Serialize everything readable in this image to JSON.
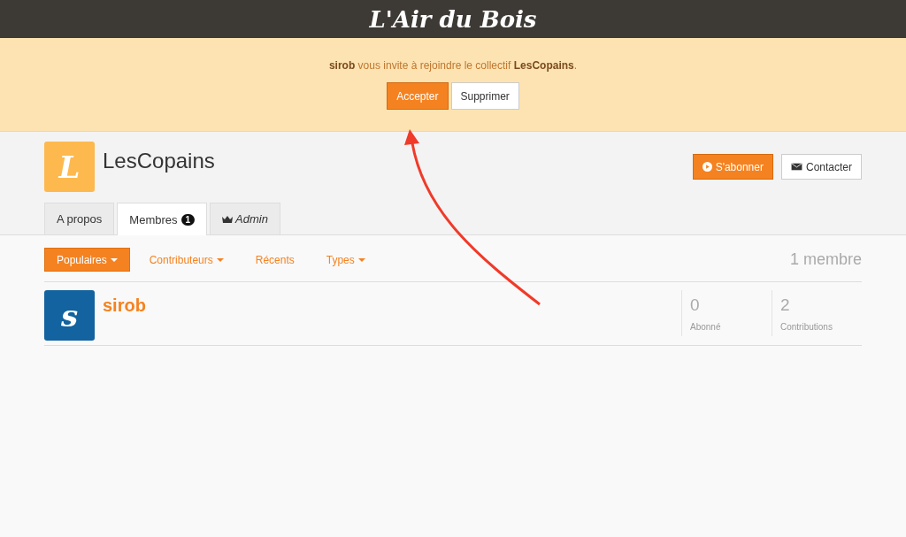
{
  "header": {
    "logo": "L'Air du Bois"
  },
  "invitation": {
    "sender": "sirob",
    "message": "vous invite à rejoindre le collectif",
    "collective": "LesCopains",
    "end": ".",
    "buttons": [
      {
        "label": "Accepter",
        "kind": "primary"
      },
      {
        "label": "Supprimer",
        "kind": "default"
      }
    ]
  },
  "profile": {
    "avatar_letter": "L",
    "name": "LesCopains",
    "actions": [
      {
        "label": "S'abonner",
        "kind": "primary"
      },
      {
        "label": "Contacter",
        "kind": "default"
      }
    ]
  },
  "tabs": [
    {
      "label": "A propos",
      "selected": false,
      "kind": "plain"
    },
    {
      "label": "Membres",
      "selected": true,
      "badge": "1",
      "kind": "plain"
    },
    {
      "label": "Admin",
      "selected": false,
      "kind": "admin"
    }
  ],
  "filters": [
    {
      "label": "Populaires",
      "selected": true,
      "dropdown": true
    },
    {
      "label": "Contributeurs",
      "selected": false,
      "dropdown": true
    },
    {
      "label": "Récents",
      "selected": false,
      "dropdown": false
    },
    {
      "label": "Types",
      "selected": false,
      "dropdown": true
    }
  ],
  "member_count": "1 membre",
  "members": [
    {
      "avatar_letter": "s",
      "name": "sirob",
      "stats": [
        {
          "value": "0",
          "label": "Abonné"
        },
        {
          "value": "2",
          "label": "Contributions"
        }
      ]
    }
  ],
  "annotation": {
    "kind": "arrow"
  }
}
